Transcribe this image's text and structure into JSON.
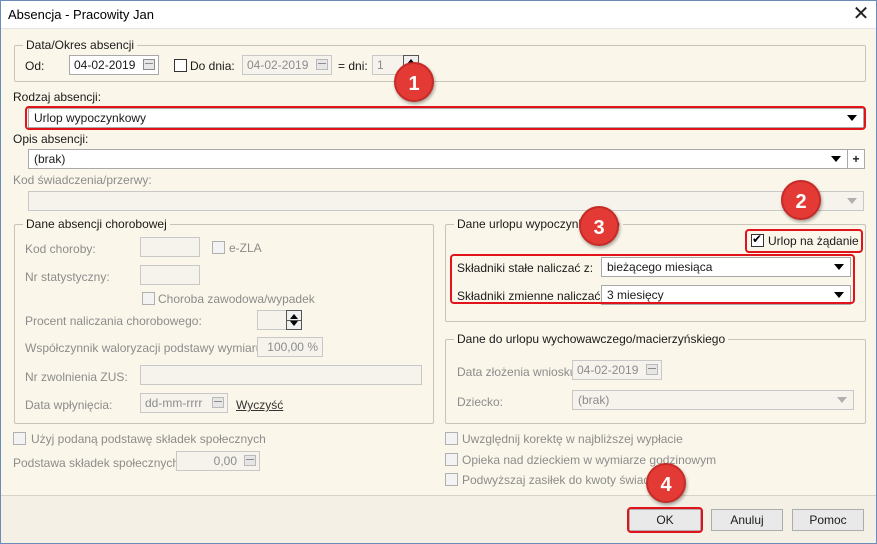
{
  "window": {
    "title": "Absencja - Pracowity Jan",
    "close_glyph": "✕"
  },
  "period": {
    "group_title": "Data/Okres absencji",
    "from_label": "Od:",
    "from_value": "04-02-2019",
    "to_label": "Do dnia:",
    "to_value": "04-02-2019",
    "days_label": "= dni:",
    "days_value": "1"
  },
  "type": {
    "label": "Rodzaj absencji:",
    "value": "Urlop wypoczynkowy"
  },
  "description": {
    "label": "Opis absencji:",
    "value": "(brak)",
    "add_glyph": "+"
  },
  "benefit_code": {
    "label": "Kod świadczenia/przerwy:",
    "value": ""
  },
  "sick": {
    "group_title": "Dane absencji chorobowej",
    "disease_code_label": "Kod choroby:",
    "ezla_label": "e-ZLA",
    "stat_number_label": "Nr statystyczny:",
    "occupational_label": "Choroba zawodowa/wypadek",
    "percent_label": "Procent naliczania chorobowego:",
    "valorization_label": "Współczynnik waloryzacji podstawy wymiaru:",
    "valorization_value": "100,00 %",
    "zus_number_label": "Nr zwolnienia ZUS:",
    "receipt_date_label": "Data wpłynięcia:",
    "receipt_date_value": "dd-mm-rrrr",
    "clear_link": "Wyczyść"
  },
  "vacation": {
    "group_title": "Dane urlopu wypoczynkowego",
    "on_demand_label": "Urlop na żądanie",
    "fixed_label": "Składniki stałe naliczać z:",
    "fixed_value": "bieżącego miesiąca",
    "variable_label": "Składniki zmienne naliczać z:",
    "variable_value": "3 miesięcy"
  },
  "parental": {
    "group_title": "Dane do urlopu wychowawczego/macierzyńskiego",
    "application_date_label": "Data złożenia wniosku:",
    "application_date_value": "04-02-2019",
    "child_label": "Dziecko:",
    "child_value": "(brak)"
  },
  "social": {
    "use_base_label": "Użyj podaną podstawę składek społecznych",
    "base_label": "Podstawa składek społecznych:",
    "base_value": "0,00"
  },
  "options": {
    "correction_label": "Uwzględnij korektę w najbliższej wypłacie",
    "care_label": "Opieka nad dzieckiem w wymiarze godzinowym",
    "raise_label": "Podwyższaj zasiłek do kwoty świadczenia"
  },
  "buttons": {
    "ok": "OK",
    "cancel": "Anuluj",
    "help": "Pomoc"
  },
  "badges": {
    "b1": "1",
    "b2": "2",
    "b3": "3",
    "b4": "4"
  },
  "colors": {
    "highlight": "#e0141a",
    "badge": "#e43a35",
    "background": "#fbf6ea"
  }
}
